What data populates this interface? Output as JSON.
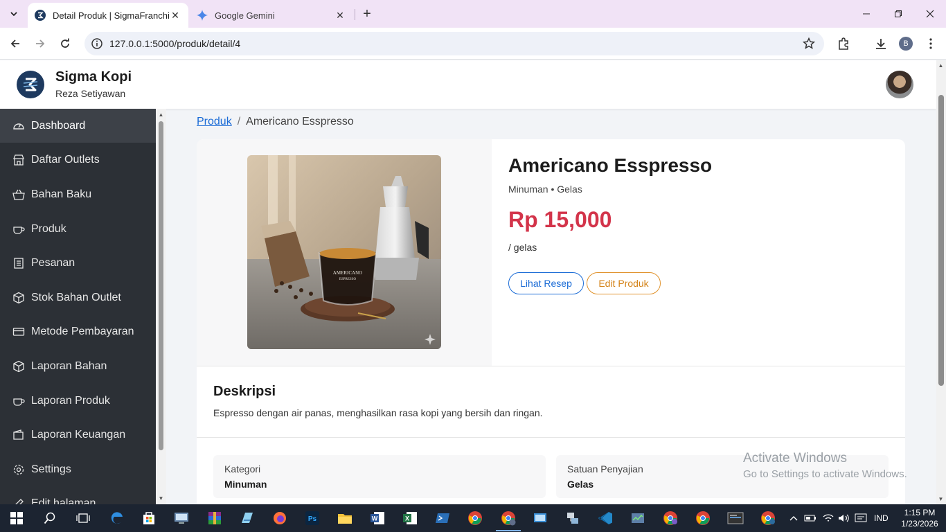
{
  "browser": {
    "tabs": [
      {
        "title": "Detail Produk | SigmaFranchise",
        "active": true,
        "icon": "sigma-favicon"
      },
      {
        "title": "Google Gemini",
        "active": false,
        "icon": "gemini-favicon"
      }
    ],
    "url": "127.0.0.1:5000/produk/detail/4",
    "profile_initial": "B"
  },
  "header": {
    "brand_name": "Sigma Kopi",
    "user_name": "Reza Setiyawan"
  },
  "sidebar": {
    "items": [
      {
        "label": "Dashboard",
        "icon": "dashboard-gauge-icon",
        "active": true
      },
      {
        "label": "Daftar Outlets",
        "icon": "outlet-icon"
      },
      {
        "label": "Bahan Baku",
        "icon": "basket-icon"
      },
      {
        "label": "Produk",
        "icon": "cup-icon"
      },
      {
        "label": "Pesanan",
        "icon": "list-icon"
      },
      {
        "label": "Stok Bahan Outlet",
        "icon": "box-icon"
      },
      {
        "label": "Metode Pembayaran",
        "icon": "card-icon"
      },
      {
        "label": "Laporan Bahan",
        "icon": "box-icon"
      },
      {
        "label": "Laporan Produk",
        "icon": "cup-icon"
      },
      {
        "label": "Laporan Keuangan",
        "icon": "wallet-icon"
      },
      {
        "label": "Settings",
        "icon": "gear-icon"
      },
      {
        "label": "Edit halaman",
        "icon": "edit-icon"
      }
    ]
  },
  "breadcrumb": {
    "parent": "Produk",
    "separator": "/",
    "current": "Americano Esspresso"
  },
  "product": {
    "name": "Americano Esspresso",
    "meta": "Minuman • Gelas",
    "price": "Rp 15,000",
    "unit": "/ gelas",
    "buttons": {
      "recipe": "Lihat Resep",
      "edit": "Edit Produk"
    },
    "description_title": "Deskripsi",
    "description": "Espresso dengan air panas, menghasilkan rasa kopi yang bersih dan ringan.",
    "info": [
      {
        "label": "Kategori",
        "value": "Minuman"
      },
      {
        "label": "Satuan Penyajian",
        "value": "Gelas"
      }
    ],
    "cup_text_1": "AMERICANO",
    "cup_text_2": "ESPRESSO"
  },
  "watermark": {
    "line1": "Activate Windows",
    "line2": "Go to Settings to activate Windows."
  },
  "taskbar": {
    "language": "IND",
    "time": "1:15 PM",
    "date": "1/23/2026"
  },
  "colors": {
    "sidebar_bg": "#2c3036",
    "price": "#d3344a",
    "link": "#1a6bd6",
    "edit_accent": "#e0922b"
  }
}
